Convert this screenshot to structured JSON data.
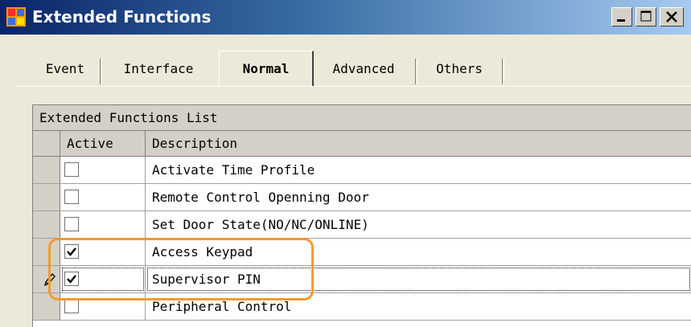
{
  "window": {
    "title": "Extended Functions",
    "buttons": [
      "minimize-icon",
      "maximize-icon",
      "close-icon"
    ]
  },
  "tabs": [
    {
      "label": "Event",
      "active": false
    },
    {
      "label": "Interface",
      "active": false
    },
    {
      "label": "Normal",
      "active": true
    },
    {
      "label": "Advanced",
      "active": false
    },
    {
      "label": "Others",
      "active": false
    }
  ],
  "grid": {
    "caption": "Extended Functions List",
    "columns": {
      "active": "Active",
      "description": "Description"
    },
    "rows": [
      {
        "active": false,
        "description": "Activate Time Profile"
      },
      {
        "active": false,
        "description": "Remote Control Openning Door"
      },
      {
        "active": false,
        "description": "Set Door State(NO/NC/ONLINE)"
      },
      {
        "active": true,
        "description": "Access Keypad"
      },
      {
        "active": true,
        "description": "Supervisor PIN",
        "editing": true
      },
      {
        "active": false,
        "description": "Peripheral Control"
      }
    ]
  },
  "colors": {
    "title_gradient_start": "#0a246a",
    "title_gradient_end": "#a6caf0",
    "annotation": "#f39a2e",
    "face": "#ece9d8"
  }
}
